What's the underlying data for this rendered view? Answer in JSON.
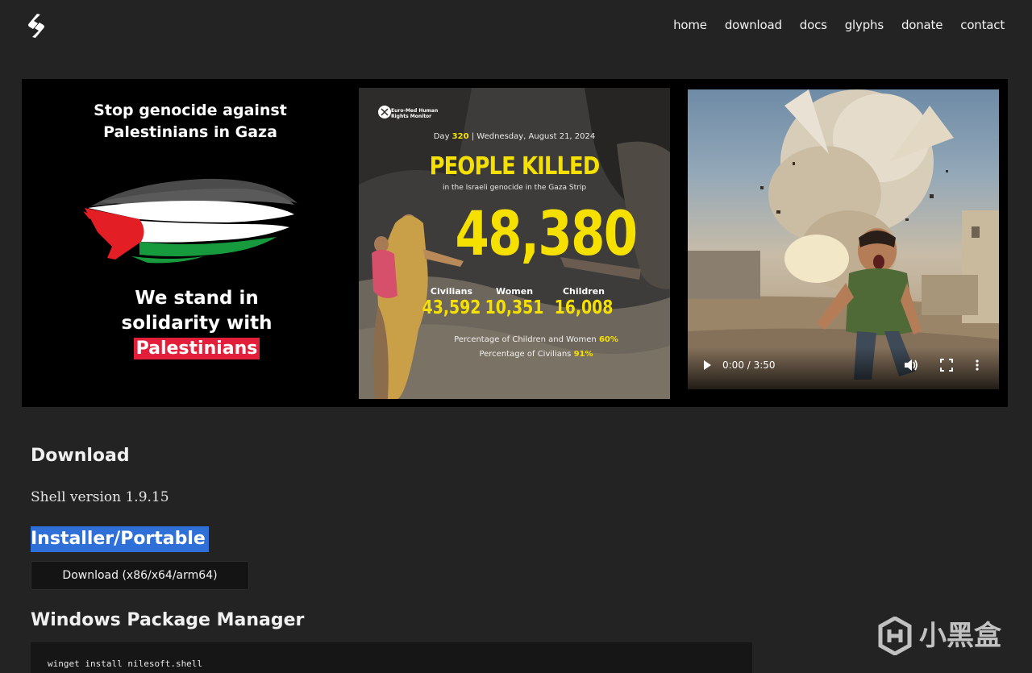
{
  "nav": {
    "items": [
      "home",
      "download",
      "docs",
      "glyphs",
      "donate",
      "contact"
    ]
  },
  "banner": {
    "panel1": {
      "title_line1": "Stop genocide against",
      "title_line2": "Palestinians in Gaza",
      "stand_line1": "We stand in",
      "stand_line2": "solidarity with",
      "highlight": "Palestinians",
      "colors": {
        "highlight_bg": "#e31e3b",
        "flag_red": "#e31e25",
        "flag_green": "#179a3d"
      }
    },
    "panel2": {
      "org_line1": "Euro-Med Human",
      "org_line2": "Rights Monitor",
      "day_prefix": "Day",
      "day_number": "320",
      "day_suffix": "| Wednesday, August 21, 2024",
      "headline": "PEOPLE KILLED",
      "subline": "in the Israeli genocide in the Gaza Strip",
      "total": "48,380",
      "stats": [
        {
          "label": "Civilians",
          "value": "43,592"
        },
        {
          "label": "Women",
          "value": "10,351"
        },
        {
          "label": "Children",
          "value": "16,008"
        }
      ],
      "pct_children_women_label": "Percentage of Children and Women",
      "pct_children_women_value": "60%",
      "pct_civilians_label": "Percentage of Civilians",
      "pct_civilians_value": "91%",
      "colors": {
        "accent": "#f6e000"
      }
    },
    "video": {
      "time": "0:00 / 3:50",
      "icons": [
        "play-icon",
        "volume-icon",
        "fullscreen-icon",
        "more-options-icon"
      ]
    }
  },
  "content": {
    "download_heading": "Download",
    "version_text": "Shell version 1.9.15",
    "installer_heading": "Installer/Portable",
    "download_button": "Download (x86/x64/arm64)",
    "winget_heading": "Windows Package Manager",
    "winget_command": "winget install nilesoft.shell",
    "colors": {
      "selection": "#2f6fd8",
      "background": "#232323"
    }
  },
  "watermark": {
    "text": "小黑盒"
  }
}
